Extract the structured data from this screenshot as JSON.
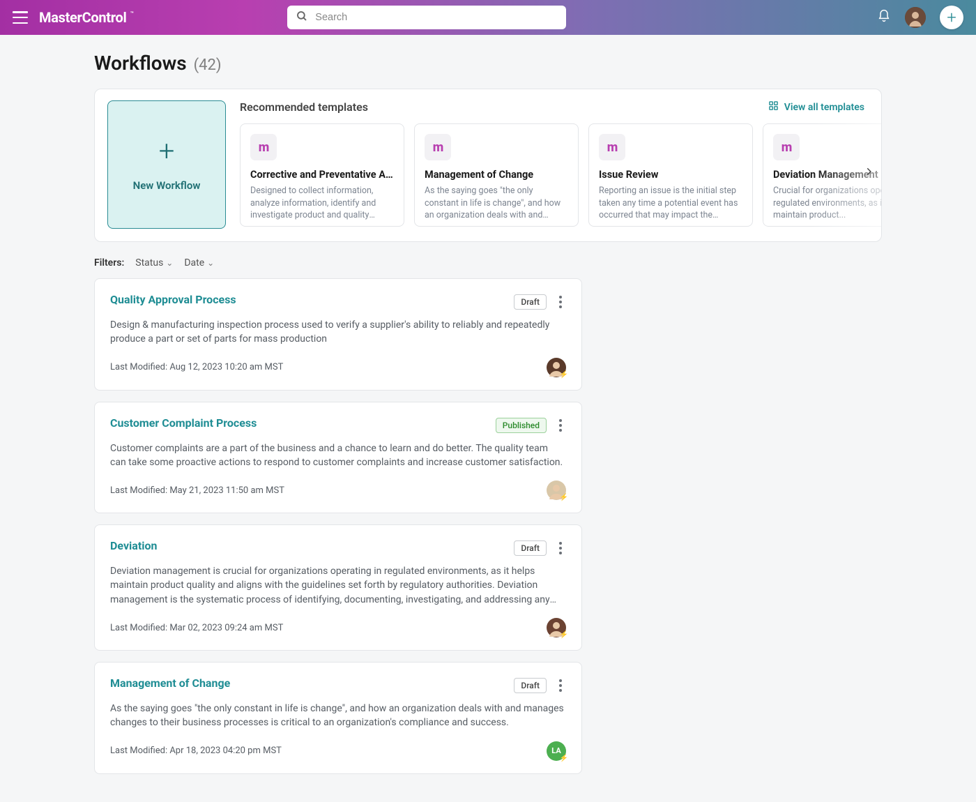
{
  "brand": "MasterControl",
  "search": {
    "placeholder": "Search"
  },
  "page": {
    "title": "Workflows",
    "count": "(42)"
  },
  "recommended": {
    "new_workflow_label": "New Workflow",
    "heading": "Recommended templates",
    "view_all_label": "View all templates",
    "templates": [
      {
        "title": "Corrective and Preventative A...",
        "desc": "Designed to collect information, analyze information, identify and investigate product and quality prob..."
      },
      {
        "title": "Management of Change",
        "desc": "As the saying goes \"the only constant in life is change\", and how an organization deals with and manage..."
      },
      {
        "title": "Issue Review",
        "desc": "Reporting an issue is the initial step taken any time a potential event has occurred that may impact the qualit..."
      },
      {
        "title": "Deviation Management",
        "desc": "Crucial for organizations operating in regulated environments, as it helps maintain product..."
      }
    ]
  },
  "filters": {
    "label": "Filters:",
    "status_label": "Status",
    "date_label": "Date"
  },
  "workflows": [
    {
      "title": "Quality Approval Process",
      "status": "Draft",
      "status_kind": "draft",
      "desc": "Design & manufacturing inspection process used to verify a supplier's ability to reliably and repeatedly produce a part or set of parts for mass production",
      "modified": "Last Modified: Aug 12, 2023 10:20 am MST",
      "avatar_bg": "#5a3a2a",
      "avatar_initials": "",
      "bolt_color": "#c93dc9"
    },
    {
      "title": "Customer Complaint Process",
      "status": "Published",
      "status_kind": "published",
      "desc": "Customer complaints are a part of the business and a chance to learn and do better. The quality team can take some proactive actions to respond to customer complaints and increase customer satisfaction.",
      "modified": "Last Modified: May 21, 2023 11:50 am MST",
      "avatar_bg": "#d9c7a8",
      "avatar_initials": "",
      "bolt_color": "#2a74d9"
    },
    {
      "title": "Deviation",
      "status": "Draft",
      "status_kind": "draft",
      "desc": "Deviation management is crucial for organizations operating in regulated environments, as it helps maintain product quality and aligns with the guidelines set forth by regulatory authorities. Deviation management is the systematic process of identifying, documenting, investigating, and addressing any unexpected or unplanned...",
      "modified": "Last Modified: Mar 02, 2023 09:24 am MST",
      "avatar_bg": "#6b4232",
      "avatar_initials": "",
      "bolt_color": "#c93dc9"
    },
    {
      "title": "Management of Change",
      "status": "Draft",
      "status_kind": "draft",
      "desc": "As the saying goes \"the only constant in life is change\", and how an organization deals with and manages changes to their business processes is critical to an organization's compliance and success.",
      "modified": "Last Modified: Apr 18, 2023 04:20 pm MST",
      "avatar_bg": "#4caf50",
      "avatar_initials": "LA",
      "bolt_color": "#2a8a2a"
    }
  ]
}
